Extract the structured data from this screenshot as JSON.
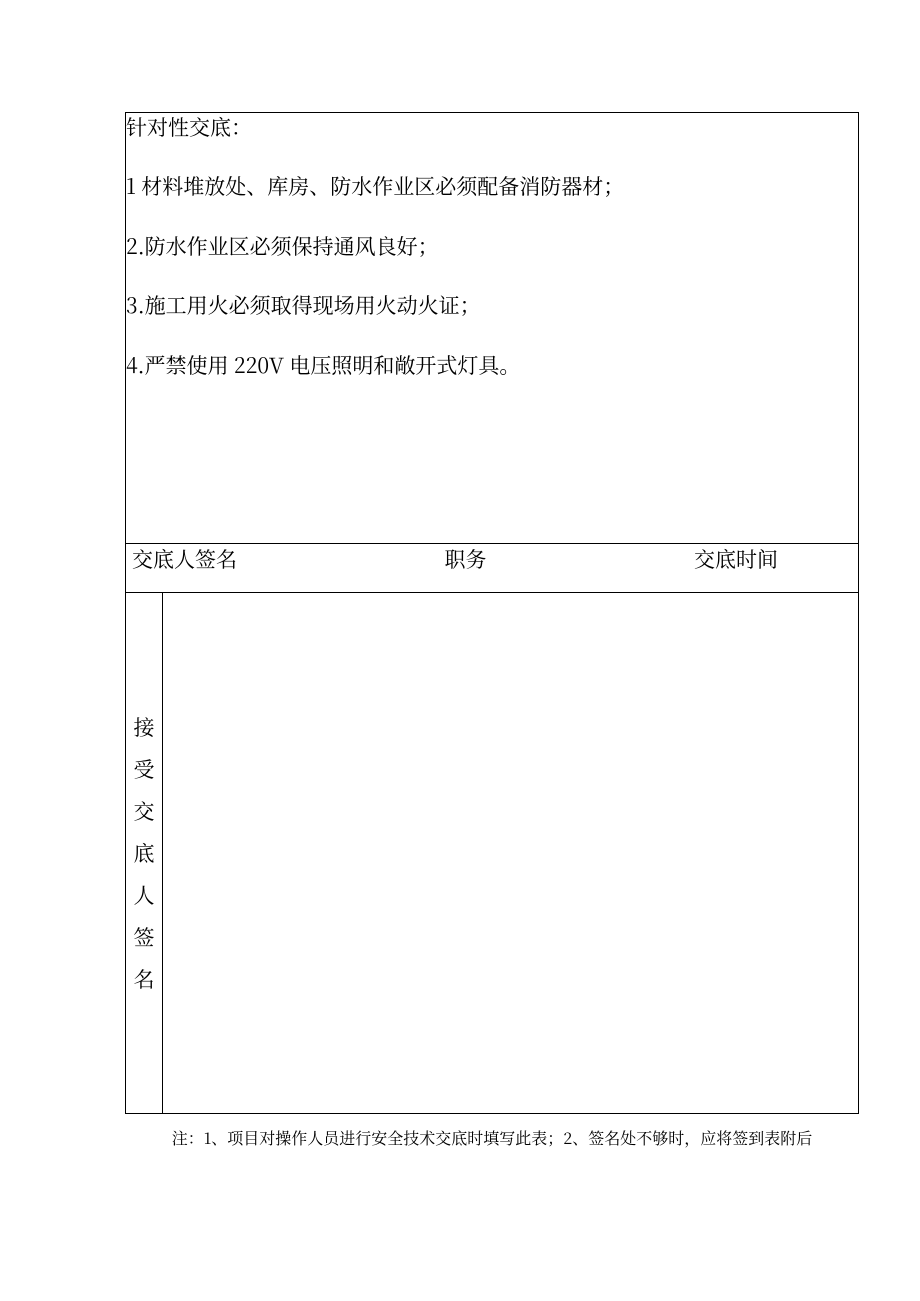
{
  "content": {
    "heading": "针对性交底：",
    "item1": "1 材料堆放处、库房、防水作业区必须配备消防器材；",
    "item2": "2.防水作业区必须保持通风良好；",
    "item3": "3.施工用火必须取得现场用火动火证；",
    "item4": "4.严禁使用 220V 电压照明和敞开式灯具。"
  },
  "signature_row": {
    "presenter_label": "交底人签名",
    "position_label": "职务",
    "time_label": "交底时间"
  },
  "receiver": {
    "vertical_label": "接受交底人签名"
  },
  "footnote": "注：1、项目对操作人员进行安全技术交底时填写此表；2、签名处不够时，应将签到表附后"
}
